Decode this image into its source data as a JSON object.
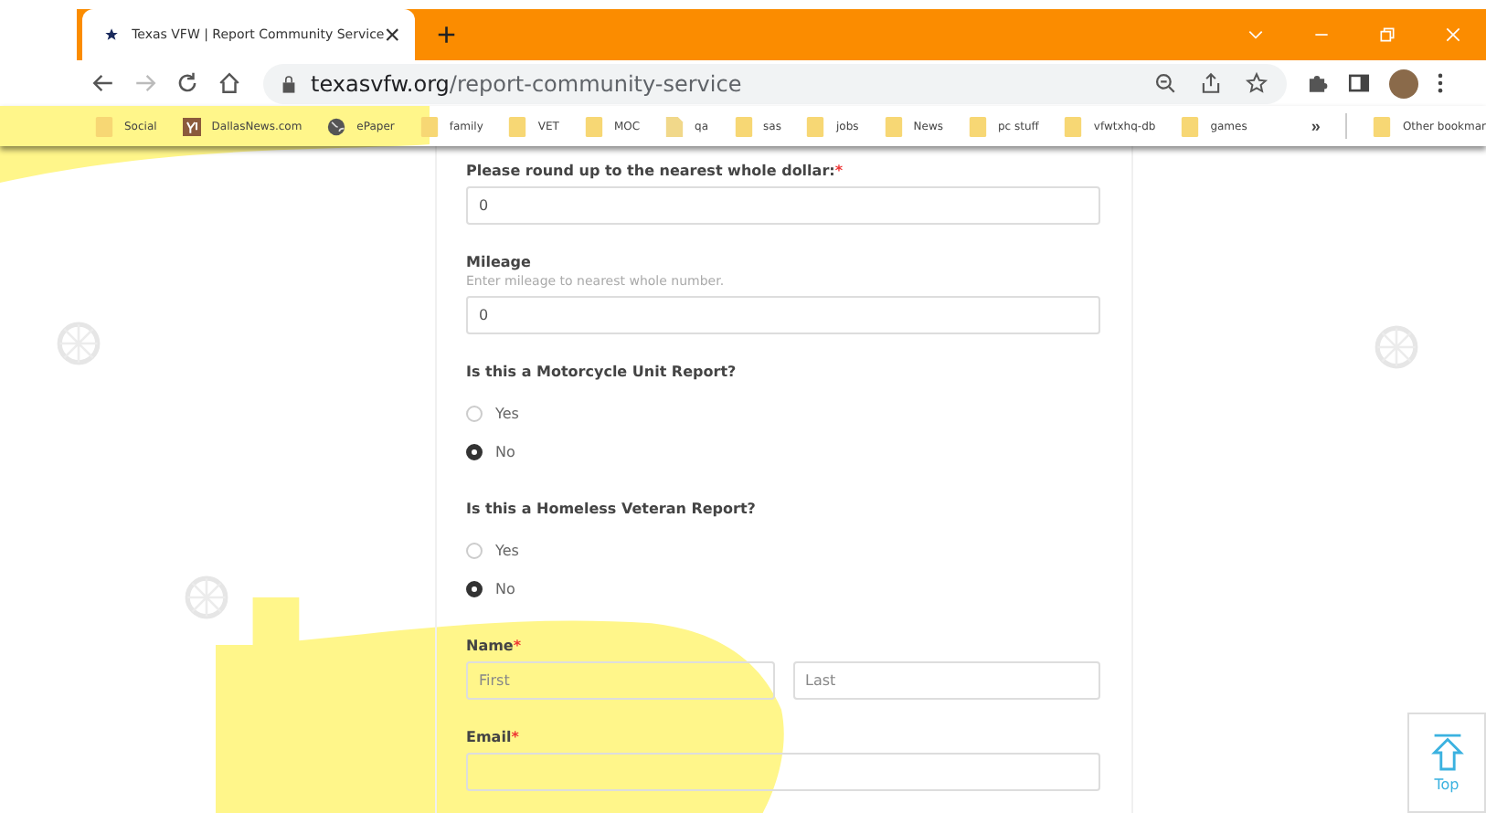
{
  "tab": {
    "title": "Texas VFW | Report Community Service",
    "close": "×",
    "new_tab": "+"
  },
  "address_bar": {
    "domain": "texasvfw.org",
    "path": "/report-community-service"
  },
  "bookmarks": [
    {
      "label": "Social",
      "kind": "folder"
    },
    {
      "label": "DallasNews.com",
      "kind": "site"
    },
    {
      "label": "ePaper",
      "kind": "globe"
    },
    {
      "label": "family",
      "kind": "folder"
    },
    {
      "label": "VET",
      "kind": "folder"
    },
    {
      "label": "MOC",
      "kind": "folder"
    },
    {
      "label": "qa",
      "kind": "page"
    },
    {
      "label": "sas",
      "kind": "folder"
    },
    {
      "label": "jobs",
      "kind": "folder"
    },
    {
      "label": "News",
      "kind": "folder"
    },
    {
      "label": "pc stuff",
      "kind": "folder"
    },
    {
      "label": "vfwtxhq-db",
      "kind": "folder"
    },
    {
      "label": "games",
      "kind": "folder"
    }
  ],
  "bookmarks_more": "»",
  "other_bookmarks": "Other bookmar",
  "form": [
    {
      "kind": "text",
      "label": "Please round up to the nearest whole dollar:",
      "required_mark": "*",
      "value": "0"
    },
    {
      "kind": "text",
      "label": "Mileage",
      "hint": "Enter mileage to nearest whole number.",
      "value": "0"
    },
    {
      "kind": "radio",
      "label": "Is this a Motorcycle Unit Report?",
      "options": [
        {
          "label": "Yes",
          "selected": false
        },
        {
          "label": "No",
          "selected": true
        }
      ]
    },
    {
      "kind": "radio",
      "label": "Is this a Homeless Veteran Report?",
      "options": [
        {
          "label": "Yes",
          "selected": false
        },
        {
          "label": "No",
          "selected": true
        }
      ]
    },
    {
      "kind": "name",
      "label": "Name",
      "required_mark": "*",
      "placeholders": [
        "First",
        "Last"
      ]
    },
    {
      "kind": "text",
      "label": "Email",
      "required_mark": "*"
    }
  ],
  "top_button": "Top"
}
